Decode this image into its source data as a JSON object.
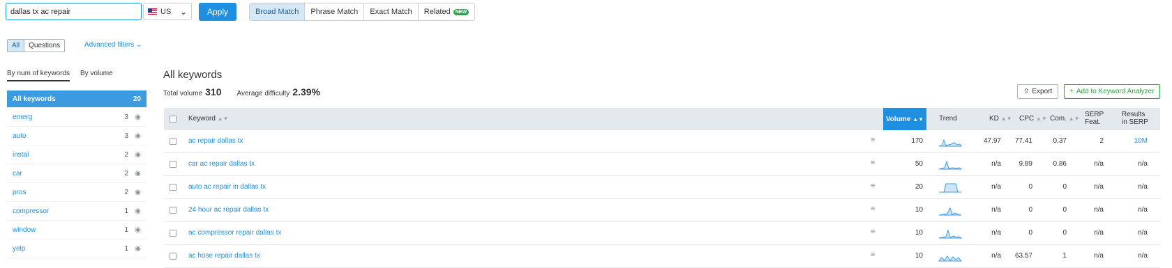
{
  "search": {
    "query": "dallas tx ac repair",
    "database": "US",
    "apply_label": "Apply"
  },
  "match_tabs": [
    {
      "label": "Broad Match",
      "active": true
    },
    {
      "label": "Phrase Match",
      "active": false
    },
    {
      "label": "Exact Match",
      "active": false
    },
    {
      "label": "Related",
      "active": false,
      "badge": "NEW"
    }
  ],
  "filters": {
    "all_label": "All",
    "questions_label": "Questions",
    "advanced_label": "Advanced filters"
  },
  "sidebar": {
    "tabs": [
      "By num of keywords",
      "By volume"
    ],
    "items": [
      {
        "label": "All keywords",
        "count": "20"
      },
      {
        "label": "emerg",
        "count": "3"
      },
      {
        "label": "auto",
        "count": "3"
      },
      {
        "label": "instal",
        "count": "2"
      },
      {
        "label": "car",
        "count": "2"
      },
      {
        "label": "pros",
        "count": "2"
      },
      {
        "label": "compressor",
        "count": "1"
      },
      {
        "label": "window",
        "count": "1"
      },
      {
        "label": "yelp",
        "count": "1"
      }
    ]
  },
  "main": {
    "title": "All keywords",
    "total_volume_label": "Total volume",
    "total_volume": "310",
    "avg_difficulty_label": "Average difficulty",
    "avg_difficulty": "2.39%",
    "export_label": "Export",
    "analyzer_label": "Add to Keyword Analyzer"
  },
  "table": {
    "headers": {
      "keyword": "Keyword",
      "volume": "Volume",
      "trend": "Trend",
      "kd": "KD",
      "cpc": "CPC",
      "com": "Com.",
      "serp1": "SERP",
      "serp2": "Feat.",
      "res1": "Results",
      "res2": "in SERP"
    },
    "rows": [
      {
        "keyword": "ac repair dallas tx",
        "volume": "170",
        "kd": "47.97",
        "cpc": "77.41",
        "com": "0.37",
        "serp": "2",
        "results": "10M"
      },
      {
        "keyword": "car ac repair dallas tx",
        "volume": "50",
        "kd": "n/a",
        "cpc": "9.89",
        "com": "0.86",
        "serp": "n/a",
        "results": "n/a"
      },
      {
        "keyword": "auto ac repair in dallas tx",
        "volume": "20",
        "kd": "n/a",
        "cpc": "0",
        "com": "0",
        "serp": "n/a",
        "results": "n/a"
      },
      {
        "keyword": "24 hour ac repair dallas tx",
        "volume": "10",
        "kd": "n/a",
        "cpc": "0",
        "com": "0",
        "serp": "n/a",
        "results": "n/a"
      },
      {
        "keyword": "ac compressor repair dallas tx",
        "volume": "10",
        "kd": "n/a",
        "cpc": "0",
        "com": "0",
        "serp": "n/a",
        "results": "n/a"
      },
      {
        "keyword": "ac hose repair dallas tx",
        "volume": "10",
        "kd": "n/a",
        "cpc": "63.57",
        "com": "1",
        "serp": "n/a",
        "results": "n/a"
      }
    ]
  },
  "colors": {
    "accent": "#1f8fe0",
    "sidebar_active": "#3c9adf",
    "green": "#2aa844",
    "header_bg": "#e4e9ee"
  }
}
